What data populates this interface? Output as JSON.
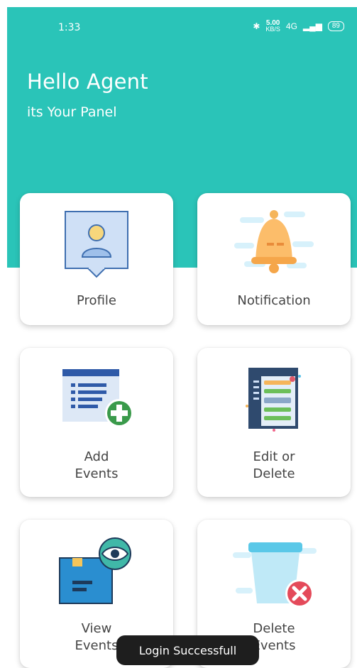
{
  "status_bar": {
    "time": "1:33",
    "bluetooth_icon": "bluetooth-icon",
    "speed_value": "5.00",
    "speed_unit": "KB/S",
    "network_label": "4G",
    "battery": "89"
  },
  "header": {
    "title": "Hello Agent",
    "subtitle": "its Your Panel",
    "color": "#2ac4b8"
  },
  "cards": {
    "profile": {
      "label": "Profile",
      "icon": "profile-icon"
    },
    "notification": {
      "label": "Notification",
      "icon": "bell-icon"
    },
    "add_events": {
      "label_line1": "Add",
      "label_line2": "Events",
      "icon": "add-list-icon"
    },
    "edit_delete": {
      "label_line1": "Edit or",
      "label_line2": "Delete",
      "icon": "edit-document-icon"
    },
    "view_events": {
      "label_line1": "View",
      "label_line2": "Events",
      "icon": "eye-folder-icon"
    },
    "delete_events": {
      "label_line1": "Delete",
      "label_line2": "Events",
      "icon": "trash-icon"
    }
  },
  "toast": {
    "message": "Login Successfull"
  }
}
